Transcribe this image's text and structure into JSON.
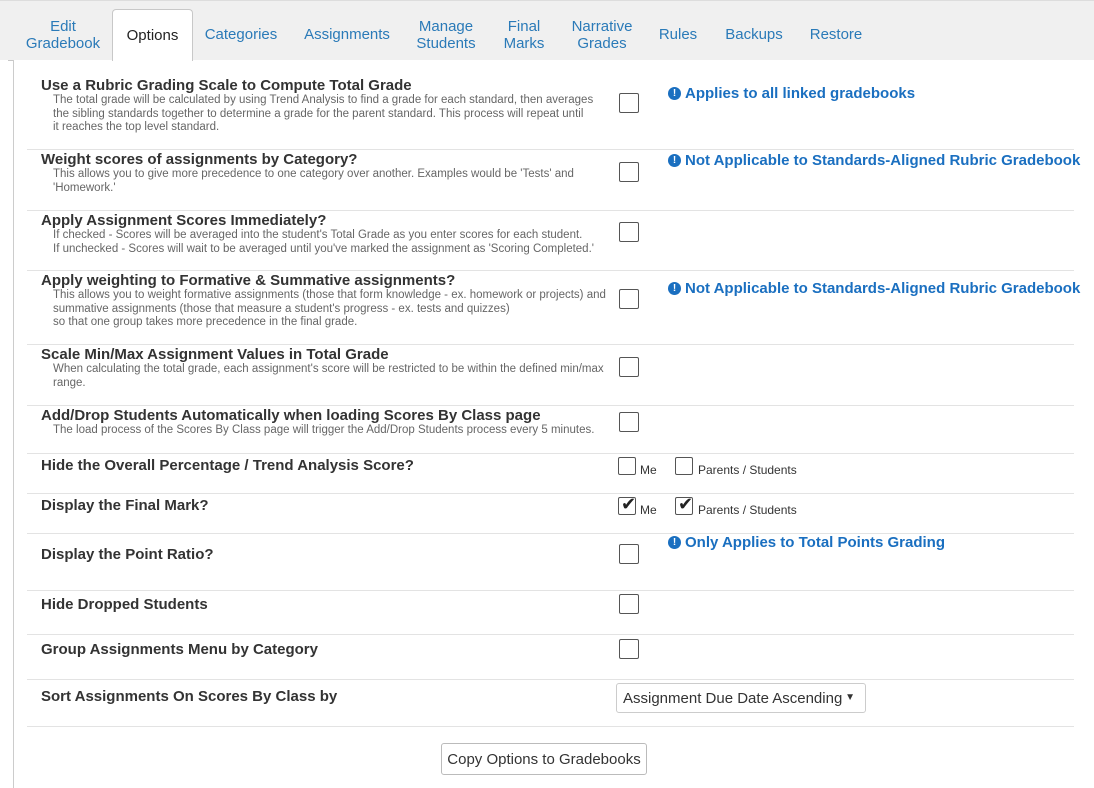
{
  "tabs": [
    {
      "label": "Edit\nGradebook"
    },
    {
      "label": "Options"
    },
    {
      "label": "Categories"
    },
    {
      "label": "Assignments"
    },
    {
      "label": "Manage\nStudents"
    },
    {
      "label": "Final\nMarks"
    },
    {
      "label": "Narrative\nGrades"
    },
    {
      "label": "Rules"
    },
    {
      "label": "Backups"
    },
    {
      "label": "Restore"
    }
  ],
  "options": [
    {
      "title": "Use a Rubric Grading Scale to Compute Total Grade",
      "description": "The total grade will be calculated by using Trend Analysis to find a grade for each standard, then averages\nthe sibling standards together to determine a grade for the parent standard. This process will repeat until\nit reaches the top level standard.",
      "note": "Applies to all linked gradebooks",
      "checked": false
    },
    {
      "title": "Weight scores of assignments by Category?",
      "description": "This allows you to give more precedence to one category over another. Examples would be 'Tests' and\n'Homework.'",
      "note": "Not Applicable to Standards-Aligned Rubric Gradebook",
      "checked": false
    },
    {
      "title": "Apply Assignment Scores Immediately?",
      "description": "If checked - Scores will be averaged into the student's Total Grade as you enter scores for each student.\nIf unchecked - Scores will wait to be averaged until you've marked the assignment as 'Scoring Completed.'",
      "checked": false
    },
    {
      "title": "Apply weighting to Formative & Summative assignments?",
      "description": "This allows you to weight formative assignments (those that form knowledge - ex. homework or projects) and\nsummative assignments (those that measure a student's progress - ex. tests and quizzes)\nso that one group takes more precedence in the final grade.",
      "note": "Not Applicable to Standards-Aligned Rubric Gradebook",
      "checked": false
    },
    {
      "title": "Scale Min/Max Assignment Values in Total Grade",
      "description": "When calculating the total grade, each assignment's score will be restricted to be within the defined min/max\nrange.",
      "checked": false
    },
    {
      "title": "Add/Drop Students Automatically when loading Scores By Class page",
      "description": "The load process of the Scores By Class page will trigger the Add/Drop Students process every 5 minutes.",
      "checked": false
    },
    {
      "title": "Hide the Overall Percentage / Trend Analysis Score?",
      "me_label": "Me",
      "parents_label": "Parents / Students",
      "me_checked": false,
      "parents_checked": false
    },
    {
      "title": "Display the Final Mark?",
      "me_label": "Me",
      "parents_label": "Parents / Students",
      "me_checked": true,
      "parents_checked": true
    },
    {
      "title": "Display the Point Ratio?",
      "note": "Only Applies to Total Points Grading",
      "checked": false
    },
    {
      "title": "Hide Dropped Students",
      "checked": false
    },
    {
      "title": "Group Assignments Menu by Category",
      "checked": false
    },
    {
      "title": "Sort Assignments On Scores By Class by",
      "select_value": "Assignment Due Date Ascending"
    }
  ],
  "info_icon_glyph": "!",
  "check_glyph": "✔",
  "caret_glyph": "▼",
  "copy_button_label": "Copy Options to Gradebooks",
  "colors": {
    "link": "#2a7ab8",
    "note": "#1a6fc0"
  }
}
